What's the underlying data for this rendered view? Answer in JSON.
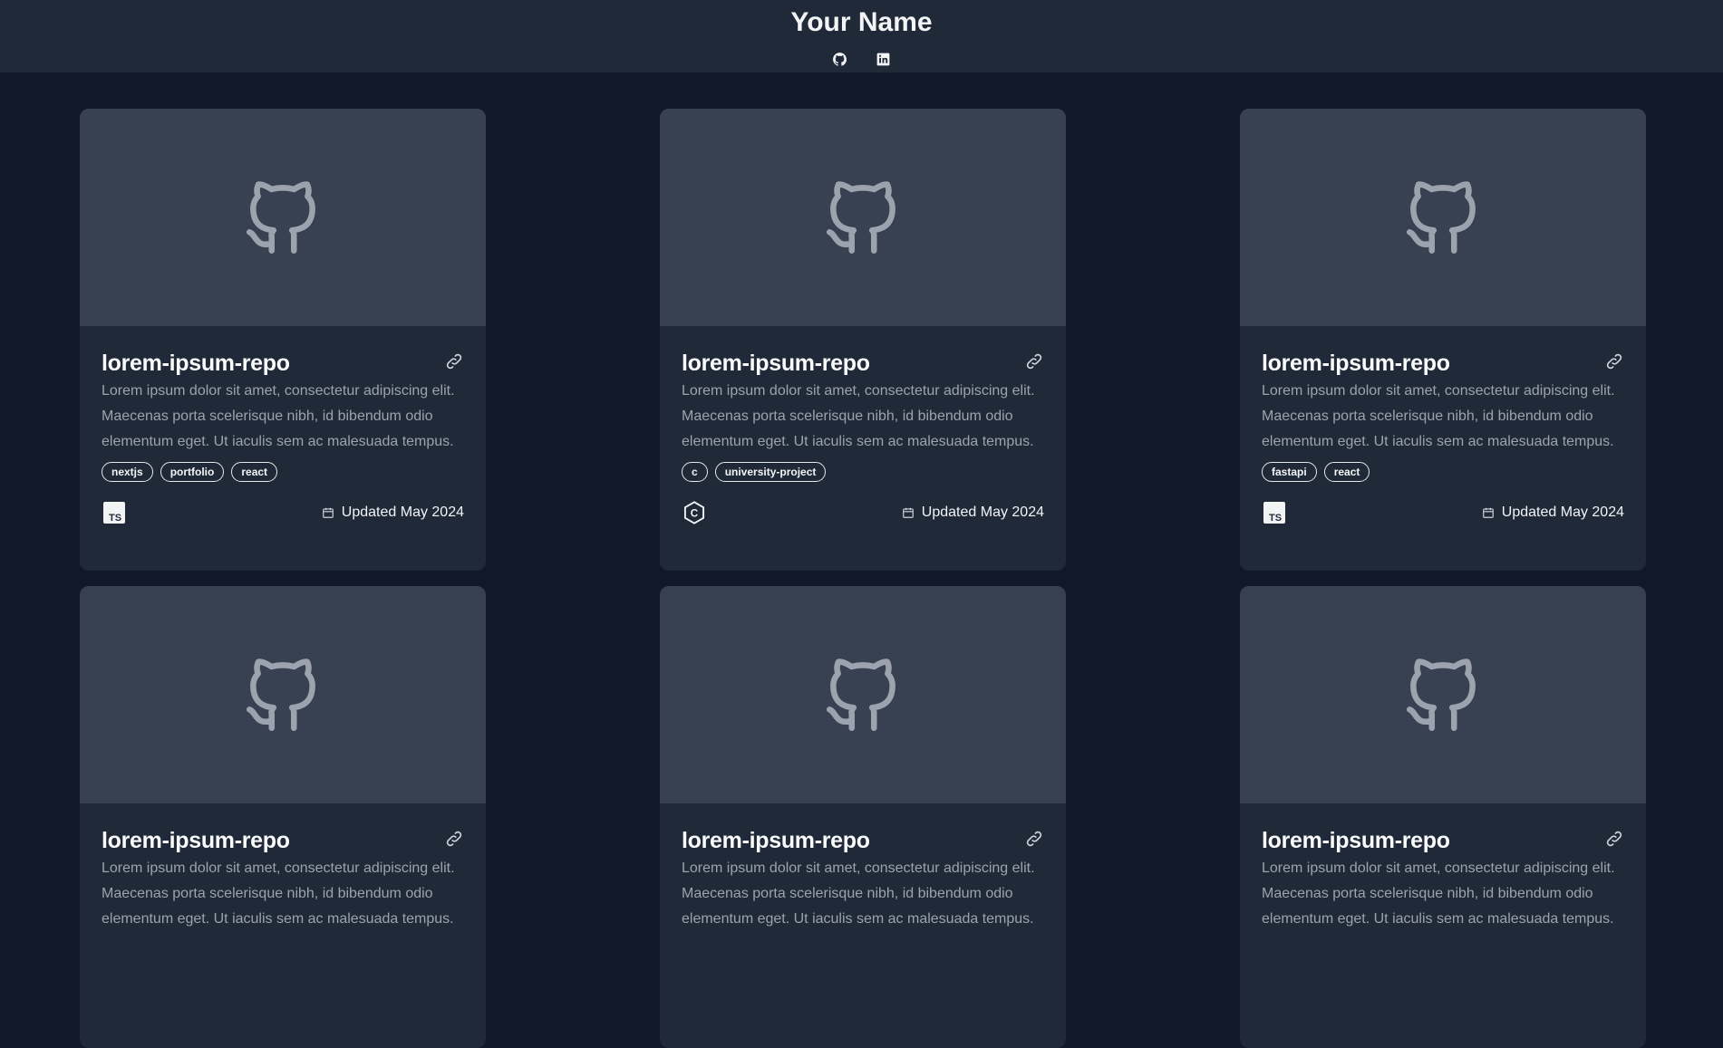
{
  "header": {
    "title": "Your Name",
    "social": [
      {
        "name": "github-icon"
      },
      {
        "name": "linkedin-icon"
      }
    ]
  },
  "colors": {
    "background": "#111827",
    "header": "#1f2937",
    "card": "#1f2937",
    "thumbnail": "#374151",
    "muted_text": "#9ca3af"
  },
  "cards": [
    {
      "title": "lorem-ipsum-repo",
      "description": "Lorem ipsum dolor sit amet, consectetur adipiscing elit. Maecenas porta scelerisque nibh, id bibendum odio elementum eget. Ut iaculis sem ac malesuada tempus.",
      "tags": [
        "nextjs",
        "portfolio",
        "react"
      ],
      "language": "TS",
      "language_icon": "typescript-icon",
      "updated": "Updated May 2024"
    },
    {
      "title": "lorem-ipsum-repo",
      "description": "Lorem ipsum dolor sit amet, consectetur adipiscing elit. Maecenas porta scelerisque nibh, id bibendum odio elementum eget. Ut iaculis sem ac malesuada tempus.",
      "tags": [
        "c",
        "university-project"
      ],
      "language": "C",
      "language_icon": "c-language-icon",
      "updated": "Updated May 2024"
    },
    {
      "title": "lorem-ipsum-repo",
      "description": "Lorem ipsum dolor sit amet, consectetur adipiscing elit. Maecenas porta scelerisque nibh, id bibendum odio elementum eget. Ut iaculis sem ac malesuada tempus.",
      "tags": [
        "fastapi",
        "react"
      ],
      "language": "TS",
      "language_icon": "typescript-icon",
      "updated": "Updated May 2024"
    },
    {
      "title": "lorem-ipsum-repo",
      "description": "Lorem ipsum dolor sit amet, consectetur adipiscing elit. Maecenas porta scelerisque nibh, id bibendum odio elementum eget. Ut iaculis sem ac malesuada tempus.",
      "tags": [],
      "language": "",
      "language_icon": "",
      "updated": ""
    },
    {
      "title": "lorem-ipsum-repo",
      "description": "Lorem ipsum dolor sit amet, consectetur adipiscing elit. Maecenas porta scelerisque nibh, id bibendum odio elementum eget. Ut iaculis sem ac malesuada tempus.",
      "tags": [],
      "language": "",
      "language_icon": "",
      "updated": ""
    },
    {
      "title": "lorem-ipsum-repo",
      "description": "Lorem ipsum dolor sit amet, consectetur adipiscing elit. Maecenas porta scelerisque nibh, id bibendum odio elementum eget. Ut iaculis sem ac malesuada tempus.",
      "tags": [],
      "language": "",
      "language_icon": "",
      "updated": ""
    }
  ]
}
